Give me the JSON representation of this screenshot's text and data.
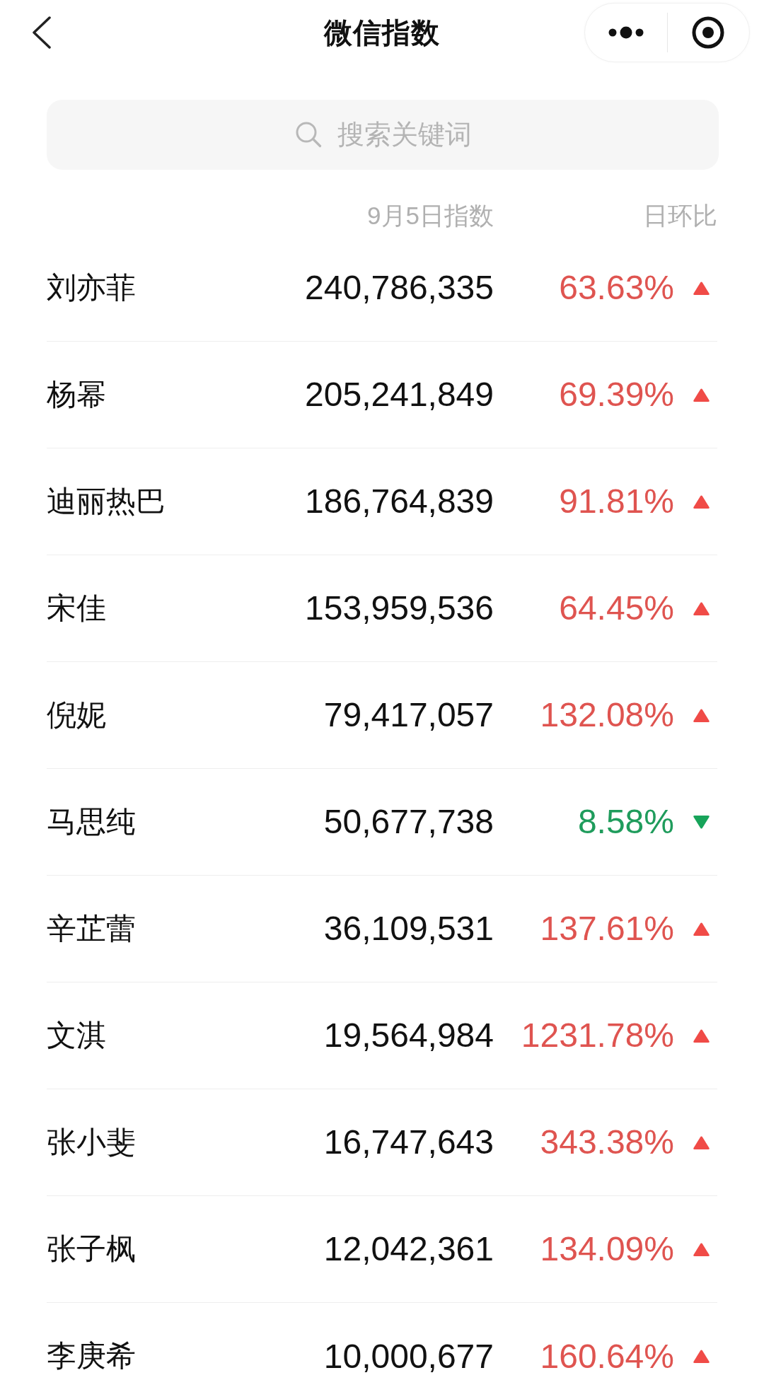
{
  "nav_bar": {
    "title": "微信指数"
  },
  "search": {
    "placeholder": "搜索关键词"
  },
  "table": {
    "columns": [
      "9月5日指数",
      "日环比"
    ],
    "rows": [
      {
        "name": "刘亦菲",
        "index": "240,786,335",
        "change": "63.63%",
        "rising": true
      },
      {
        "name": "杨幂",
        "index": "205,241,849",
        "change": "69.39%",
        "rising": true
      },
      {
        "name": "迪丽热巴",
        "index": "186,764,839",
        "change": "91.81%",
        "rising": true
      },
      {
        "name": "宋佳",
        "index": "153,959,536",
        "change": "64.45%",
        "rising": true
      },
      {
        "name": "倪妮",
        "index": "79,417,057",
        "change": "132.08%",
        "rising": true
      },
      {
        "name": "马思纯",
        "index": "50,677,738",
        "change": "8.58%",
        "rising": false
      },
      {
        "name": "辛芷蕾",
        "index": "36,109,531",
        "change": "137.61%",
        "rising": true
      },
      {
        "name": "文淇",
        "index": "19,564,984",
        "change": "1231.78%",
        "rising": true
      },
      {
        "name": "张小斐",
        "index": "16,747,643",
        "change": "343.38%",
        "rising": true
      },
      {
        "name": "张子枫",
        "index": "12,042,361",
        "change": "134.09%",
        "rising": true
      },
      {
        "name": "李庚希",
        "index": "10,000,677",
        "change": "160.64%",
        "rising": true
      }
    ]
  }
}
